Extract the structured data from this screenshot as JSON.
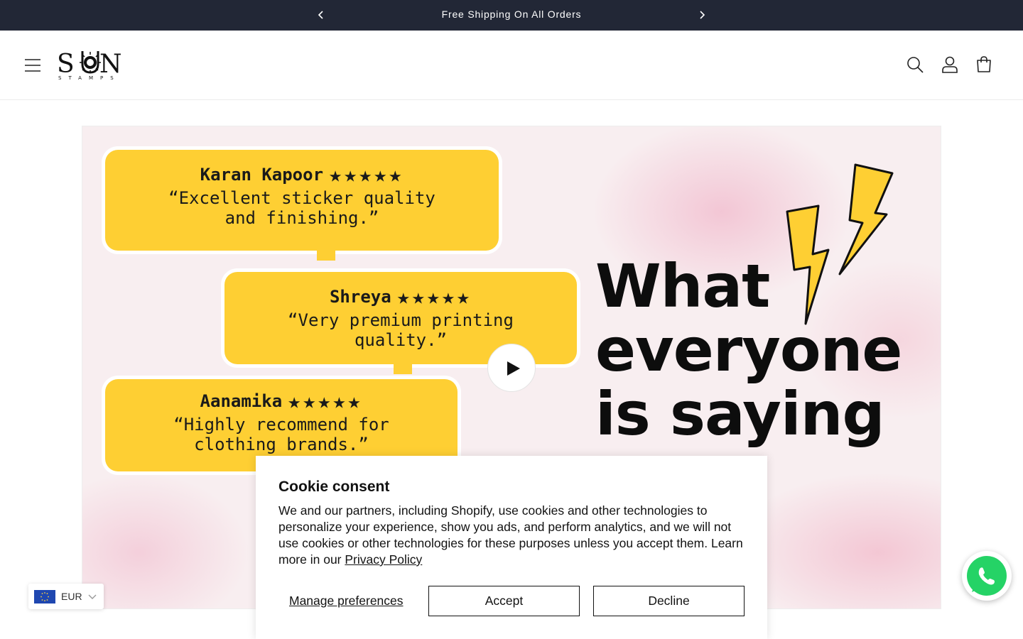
{
  "announcement": {
    "text": "Free Shipping On All Orders",
    "prev_icon": "chevron-left-icon",
    "next_icon": "chevron-right-icon"
  },
  "header": {
    "logo_text": "SUN",
    "logo_subtext": "STAMPS",
    "icons": [
      "menu-icon",
      "search-icon",
      "account-icon",
      "cart-icon"
    ]
  },
  "hero": {
    "reviews": [
      {
        "name": "Karan Kapoor",
        "stars": "★★★★★",
        "quote_line1": "“Excellent sticker quality",
        "quote_line2": "and finishing.”"
      },
      {
        "name": "Shreya",
        "stars": "★★★★★",
        "quote_line1": "“Very premium printing",
        "quote_line2": "quality.”"
      },
      {
        "name": "Aanamika",
        "stars": "★★★★★",
        "quote_line1": "“Highly recommend for",
        "quote_line2": "clothing brands.”"
      }
    ],
    "headline": [
      "What",
      "everyone",
      "is saying"
    ],
    "accent_color": "#fecf33",
    "play_icon": "play-icon"
  },
  "currency": {
    "code": "EUR",
    "flag_icon": "eu-flag-icon"
  },
  "whatsapp": {
    "icon": "whatsapp-icon",
    "brand_color": "#25d366"
  },
  "cookie": {
    "title": "Cookie consent",
    "body": "We and our partners, including Shopify, use cookies and other technologies to personalize your experience, show you ads, and perform analytics, and we will not use cookies or other technologies for these purposes unless you accept them. Learn more in our ",
    "policy_link": "Privacy Policy",
    "manage_label": "Manage preferences",
    "accept_label": "Accept",
    "decline_label": "Decline"
  }
}
